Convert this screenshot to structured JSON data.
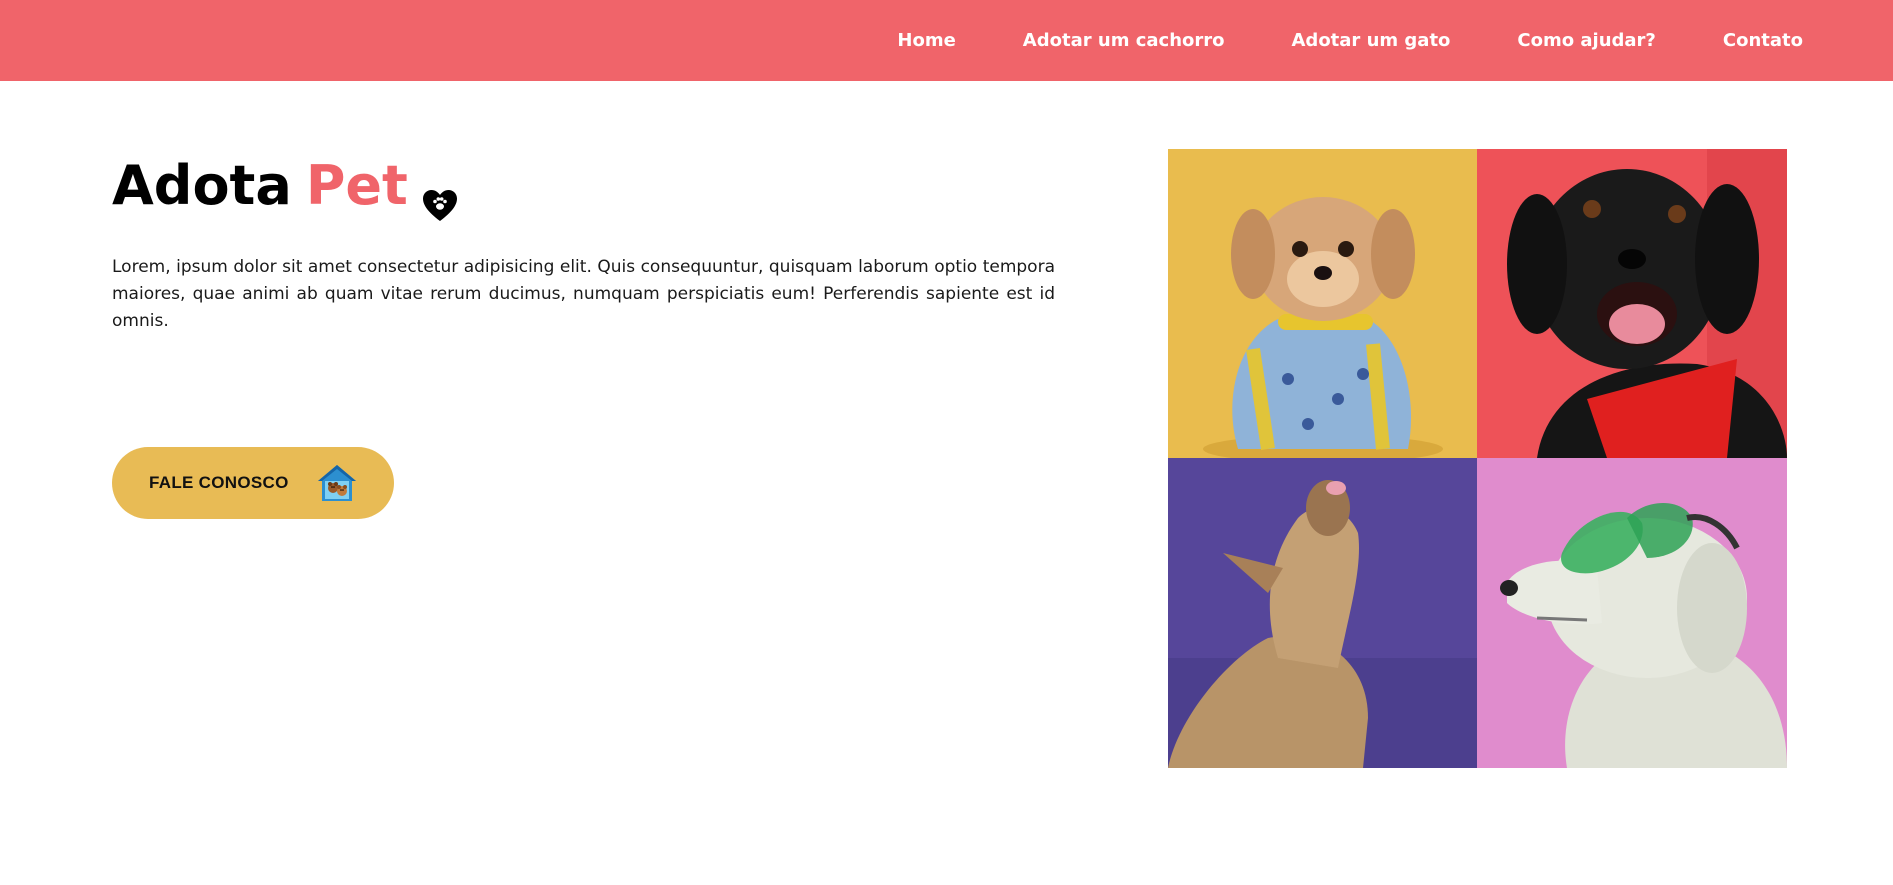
{
  "nav": {
    "items": [
      {
        "label": "Home",
        "icon": ""
      },
      {
        "label": "Adotar um cachorro"
      },
      {
        "label": "Adotar um gato"
      },
      {
        "label": "Como ajudar?"
      },
      {
        "label": "Contato"
      }
    ]
  },
  "hero": {
    "title_main": "Adota",
    "title_accent": "Pet",
    "title_icon": "heart-paw-icon",
    "description": "Lorem, ipsum dolor sit amet consectetur adipisicing elit. Quis consequuntur, quisquam laborum optio tempora maiores, quae animi ab quam vitae rerum ducimus, numquam perspiciatis eum! Perferendis sapiente est id omnis.",
    "cta_label": "FALE CONOSCO",
    "cta_icon": "pet-house-icon"
  },
  "gallery": {
    "photos": [
      {
        "subject": "small dog in blue banana sweater",
        "background": "#e9bc4e"
      },
      {
        "subject": "black dog with red bandana",
        "background": "#ee5258"
      },
      {
        "subject": "french bulldog looking up",
        "background": "#56469a"
      },
      {
        "subject": "white dog with green goggles",
        "background": "#e08ccd"
      }
    ]
  },
  "colors": {
    "primary": "#f0646a",
    "accent": "#e8bb55",
    "text": "#000000"
  }
}
